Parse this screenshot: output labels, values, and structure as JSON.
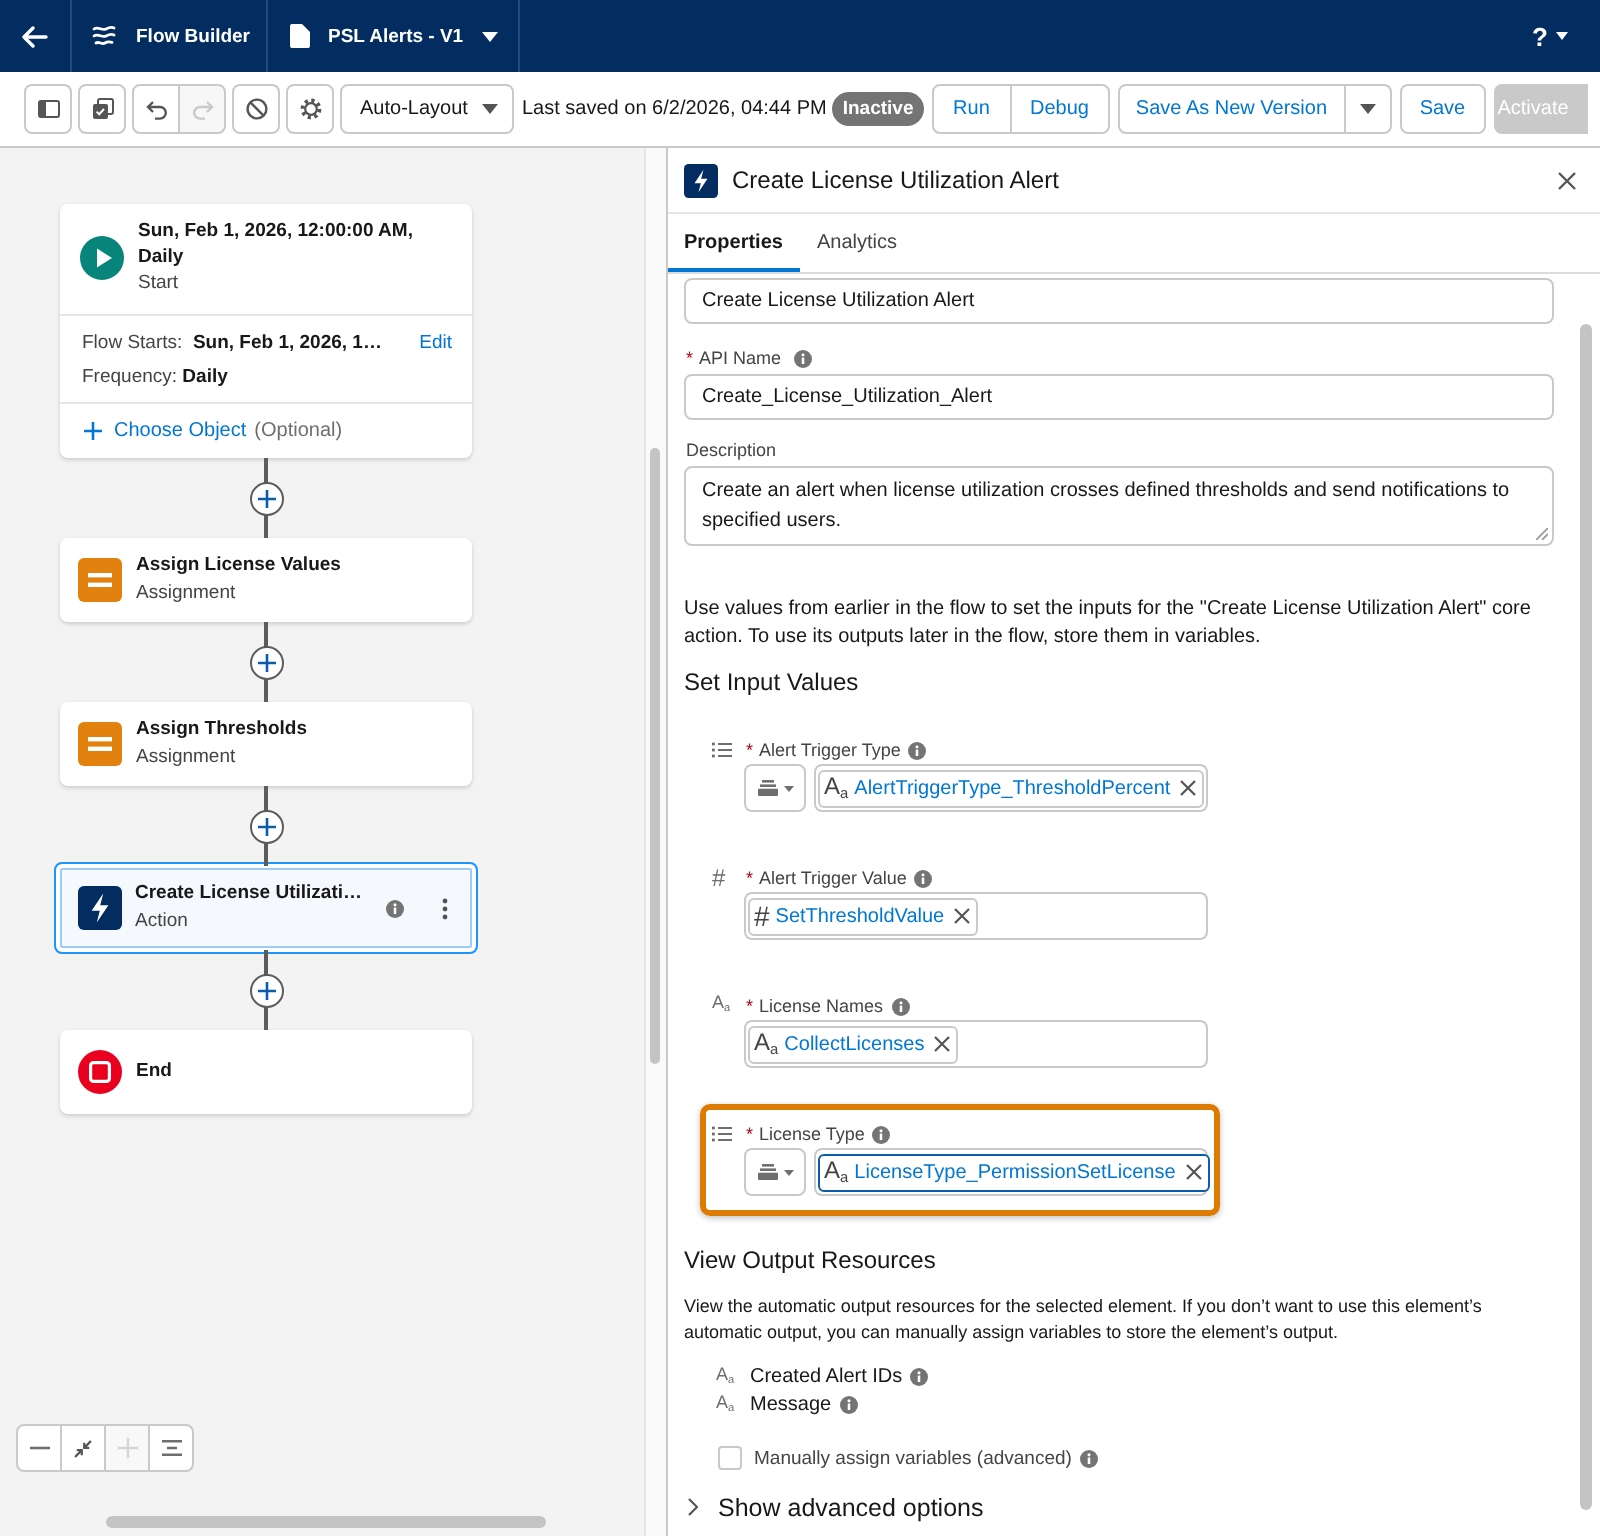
{
  "top_bar": {
    "app_name": "Flow Builder",
    "flow_name": "PSL Alerts - V1",
    "help": "?"
  },
  "toolbar": {
    "undo": {
      "disabled": false
    },
    "redo": {
      "disabled": true
    },
    "layout": "Auto-Layout",
    "last_saved": "Last saved on 6/2/2026, 04:44 PM",
    "status": "Inactive",
    "run": "Run",
    "debug": "Debug",
    "save_as": "Save As New Version",
    "save": "Save",
    "activate": {
      "label": "Activate",
      "disabled": true
    }
  },
  "canvas": {
    "start": {
      "title": "Sun, Feb 1, 2026, 12:00:00 AM, Daily",
      "type": "Start",
      "flow_starts": "Flow Starts:  **Sun, Feb 1, 2026, 1…**",
      "edit": "Edit",
      "frequency": "Frequency: **Daily**",
      "choose_object": "Choose Object",
      "optional": "(Optional)"
    },
    "nodes": [
      {
        "kind": "assignment",
        "title": "Assign License Values",
        "type": "Assignment",
        "selected": false
      },
      {
        "kind": "assignment",
        "title": "Assign Thresholds",
        "type": "Assignment",
        "selected": false
      },
      {
        "kind": "action",
        "title": "Create License Utilizati…",
        "type": "Action",
        "selected": true
      },
      {
        "kind": "end",
        "title": "End",
        "selected": false
      }
    ],
    "zoom_in": {
      "disabled": true
    }
  },
  "panel": {
    "title": "Create License Utilization Alert",
    "tabs": [
      {
        "label": "Properties",
        "selected": true
      },
      {
        "label": "Analytics",
        "selected": false
      }
    ],
    "label_value": "Create License Utilization Alert",
    "api_name": {
      "required_mark": "*",
      "label": "API Name",
      "value": "Create_License_Utilization_Alert"
    },
    "description": {
      "label": "Description",
      "value": "Create an alert when license utilization crosses defined thresholds and send notifications to specified users."
    },
    "intro": "Use values from earlier in the flow to set the inputs for the \"Create License Utilization Alert\" core action. To use its outputs later in the flow, store them in variables.",
    "inputs_heading": "Set Input Values",
    "inputs": [
      {
        "kind": "picklist",
        "required_mark": "*",
        "label": "Alert Trigger Type",
        "pill_symbol": "A$_{a}$",
        "value": "AlertTriggerType_ThresholdPercent",
        "focused": false,
        "highlighted": false
      },
      {
        "kind": "number",
        "type_symbol": "#",
        "required_mark": "*",
        "label": "Alert Trigger Value",
        "pill_symbol": "#",
        "value": "SetThresholdValue",
        "focused": false,
        "highlighted": false
      },
      {
        "kind": "text",
        "type_symbol": "A$_{a}$",
        "required_mark": "*",
        "label": "License Names",
        "pill_symbol": "A$_{a}$",
        "value": "CollectLicenses",
        "focused": false,
        "highlighted": false
      },
      {
        "kind": "picklist",
        "required_mark": "*",
        "label": "License Type",
        "pill_symbol": "A$_{a}$",
        "value": "LicenseType_PermissionSetLicense",
        "focused": true,
        "highlighted": true
      }
    ],
    "outputs_heading": "View Output Resources",
    "outputs_intro": "View the automatic output resources for the selected element. If you don’t want to use this element’s automatic output, you can manually assign variables to store the element’s output.",
    "outputs": [
      {
        "symbol": "A$_{a}$",
        "label": "Created Alert IDs"
      },
      {
        "symbol": "A$_{a}$",
        "label": "Message"
      }
    ],
    "manual_assign": {
      "label": "Manually assign variables (advanced)",
      "checked": false
    },
    "advanced": {
      "label": "Show advanced options",
      "expanded": false
    }
  }
}
